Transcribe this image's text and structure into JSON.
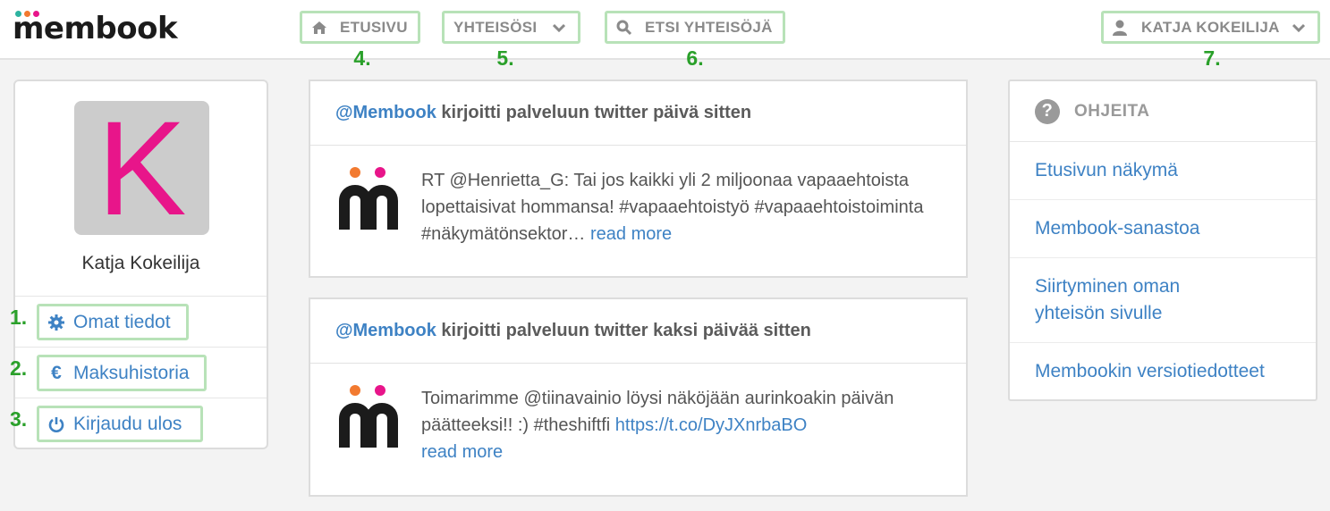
{
  "app": {
    "logo_text": "membook",
    "logo_dot_colors": [
      "#2db3a0",
      "#f27a30",
      "#e8158a"
    ]
  },
  "topnav": {
    "home": {
      "label": "ETUSIVU",
      "marker": "4.",
      "icon": "home-icon"
    },
    "communities": {
      "label": "YHTEISÖSI",
      "marker": "5.",
      "icon": "chevron-down-icon"
    },
    "search": {
      "label": "ETSI YHTEISÖJÄ",
      "marker": "6.",
      "icon": "search-icon"
    },
    "user": {
      "label": "KATJA KOKEILIJA",
      "marker": "7.",
      "icon": "user-icon"
    }
  },
  "profile": {
    "avatar_letter": "K",
    "name": "Katja Kokeilija",
    "menu": [
      {
        "label": "Omat tiedot",
        "marker": "1.",
        "icon": "gear-icon"
      },
      {
        "label": "Maksuhistoria",
        "marker": "2.",
        "icon": "euro-icon"
      },
      {
        "label": "Kirjaudu ulos",
        "marker": "3.",
        "icon": "power-icon"
      }
    ]
  },
  "feed": [
    {
      "handle": "@Membook",
      "action": " kirjoitti palveluun twitter päivä sitten",
      "text": "RT @Henrietta_G: Tai jos kaikki yli 2 miljoonaa vapaaehtoista lopettaisivat hommansa! #vapaaehtoistyö #vapaaehtoistoiminta #näkymätönsektor… ",
      "link": "",
      "read_more": "read more"
    },
    {
      "handle": "@Membook",
      "action": " kirjoitti palveluun twitter kaksi päivää sitten",
      "text": "Toimarimme @tiinavainio löysi näköjään aurinkoakin päivän päätteeksi!! :) #theshiftfi ",
      "link": "https://t.co/DyJXnrbaBO",
      "read_more": "read more"
    }
  ],
  "help": {
    "title": "OHJEITA",
    "items": [
      "Etusivun näkymä",
      "Membook-sanastoa",
      "Siirtyminen oman yhteisön sivulle",
      "Membookin versiotiedotteet"
    ]
  },
  "colors": {
    "accent": "#3e82c4",
    "highlight": "#b8e2b8",
    "marker": "#2aa02a",
    "avatar_letter": "#e8158a"
  }
}
